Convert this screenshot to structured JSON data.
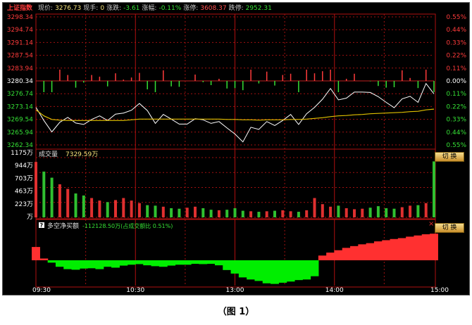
{
  "header": {
    "index_name": "上证指数",
    "price_label": "现价:",
    "price_value": "3276.73",
    "volume_now_label": "现手:",
    "volume_now_value": "0",
    "change_label": "涨跌:",
    "change_value": "-3.61",
    "change_pct_label": "涨幅:",
    "change_pct_value": "-0.11%",
    "limit_up_label": "涨停:",
    "limit_up_value": "3608.37",
    "limit_down_label": "跌停:",
    "limit_down_value": "2952.31"
  },
  "price_panel": {
    "left_ticks": [
      "3298.34",
      "3294.74",
      "3291.14",
      "3287.54",
      "3283.94",
      "3280.34",
      "3276.74",
      "3273.14",
      "3269.54",
      "3265.94",
      "3262.34"
    ],
    "right_ticks": [
      "0.55%",
      "0.44%",
      "0.33%",
      "0.22%",
      "0.11%",
      "0.00%",
      "0.11%",
      "0.22%",
      "0.33%",
      "0.44%",
      "0.55%"
    ],
    "colors": {
      "up": "#ff3b3b",
      "down": "#35e035",
      "zero": "#ffffff",
      "price_line": "#ffffff",
      "avg_line": "#e0c000"
    }
  },
  "volume_panel": {
    "label": "成交量",
    "value": "7329.59万",
    "y_ticks": [
      "1175万",
      "944万",
      "703万",
      "463万",
      "223万",
      "万"
    ],
    "button": "切 换"
  },
  "netbuy_panel": {
    "badge": "?",
    "label": "多空净买额",
    "value": "-112128.50万(占成交额比 0.51%)",
    "close_mark": "×",
    "button": "切 换"
  },
  "time_axis": [
    "09:30",
    "10:30",
    "13:00",
    "14:00",
    "15:00"
  ],
  "caption": "（图 1）",
  "chart_data": {
    "type": "line",
    "title": "",
    "xlabel": "",
    "ylabel": "",
    "x": [
      "09:30",
      "10:30",
      "13:00",
      "14:00",
      "15:00"
    ],
    "ylim": [
      3262.34,
      3298.34
    ],
    "prev_close": 3280.34,
    "series": [
      {
        "name": "",
        "kind": "price",
        "values": [
          3272.9,
          3269.2,
          3266.0,
          3268.7,
          3270.1,
          3268.5,
          3268.1,
          3269.5,
          3270.5,
          3269.2,
          3271.0,
          3271.3,
          3272.1,
          3274.0,
          3272.0,
          3268.4,
          3270.9,
          3269.6,
          3268.2,
          3268.2,
          3269.7,
          3269.4,
          3268.4,
          3268.9,
          3267.1,
          3265.4,
          3263.2,
          3267.3,
          3266.7,
          3268.9,
          3267.8,
          3269.2,
          3270.9,
          3268.1,
          3271.1,
          3272.9,
          3275.2,
          3278.2,
          3275.0,
          3275.5,
          3277.2,
          3277.2,
          3277.1,
          3275.9,
          3274.3,
          3272.8,
          3275.3,
          3276.0,
          3274.3,
          3279.6,
          3276.7
        ]
      },
      {
        "name": "",
        "kind": "average",
        "values": [
          3272.2,
          3270.5,
          3269.5,
          3269.3,
          3269.2,
          3269.2,
          3269.2,
          3269.2,
          3269.2,
          3269.2,
          3269.2,
          3269.2,
          3269.4,
          3269.6,
          3269.6,
          3269.6,
          3269.6,
          3269.6,
          3269.6,
          3269.6,
          3269.6,
          3269.6,
          3269.6,
          3269.6,
          3269.5,
          3269.5,
          3269.4,
          3269.4,
          3269.3,
          3269.4,
          3269.4,
          3269.4,
          3269.5,
          3269.5,
          3269.6,
          3269.8,
          3270.0,
          3270.3,
          3270.5,
          3270.6,
          3270.8,
          3270.9,
          3271.1,
          3271.2,
          3271.3,
          3271.4,
          3271.5,
          3271.7,
          3271.8,
          3272.2,
          3272.4
        ]
      },
      {
        "name": "",
        "kind": "volume_wan",
        "values": [
          1090,
          900,
          780,
          650,
          560,
          470,
          430,
          380,
          330,
          300,
          340,
          380,
          330,
          280,
          240,
          230,
          210,
          180,
          170,
          190,
          210,
          180,
          150,
          140,
          150,
          180,
          130,
          120,
          110,
          120,
          130,
          140,
          120,
          110,
          140,
          380,
          260,
          210,
          230,
          180,
          160,
          170,
          190,
          220,
          180,
          170,
          200,
          230,
          240,
          280,
          1100
        ]
      },
      {
        "name": "",
        "kind": "net_buy",
        "values": [
          0.45,
          0.06,
          -0.08,
          -0.22,
          -0.3,
          -0.32,
          -0.28,
          -0.27,
          -0.3,
          -0.22,
          -0.25,
          -0.18,
          -0.15,
          -0.13,
          -0.17,
          -0.2,
          -0.22,
          -0.18,
          -0.15,
          -0.15,
          -0.12,
          -0.13,
          -0.12,
          -0.17,
          -0.33,
          -0.45,
          -0.58,
          -0.65,
          -0.7,
          -0.78,
          -0.8,
          -0.76,
          -0.72,
          -0.67,
          -0.65,
          -0.54,
          0.16,
          0.26,
          0.34,
          0.42,
          0.48,
          0.54,
          0.58,
          0.64,
          0.68,
          0.72,
          0.75,
          0.8,
          0.84,
          0.88,
          0.9
        ]
      }
    ],
    "net_buy_range": [
      -0.8,
      1.0
    ]
  }
}
